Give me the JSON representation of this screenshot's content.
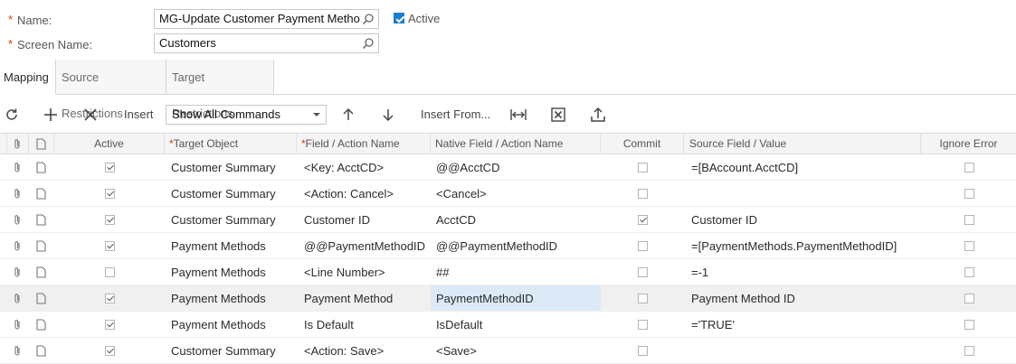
{
  "form": {
    "name_label": "Name:",
    "name_value": "MG-Update Customer Payment Metho",
    "screen_label": "Screen Name:",
    "screen_value": "Customers",
    "required_mark": "*",
    "active_label": "Active",
    "active_checked": true
  },
  "tabs": [
    {
      "label": "Mapping",
      "active": true
    },
    {
      "label": "Source Restrictions",
      "active": false
    },
    {
      "label": "Target Restrictions",
      "active": false
    }
  ],
  "toolbar": {
    "insert_label": "Insert",
    "command_filter": "Show All Commands",
    "insert_from_label": "Insert From..."
  },
  "grid": {
    "headers": {
      "active": "Active",
      "target_object": "Target Object",
      "field_action": "Field / Action Name",
      "native_field": "Native Field / Action Name",
      "commit": "Commit",
      "source_field": "Source Field / Value",
      "ignore_error": "Ignore Error"
    },
    "rows": [
      {
        "active": true,
        "target": "Customer Summary",
        "field": "<Key: AcctCD>",
        "native": "@@AcctCD",
        "commit": false,
        "source": "=[BAccount.AcctCD]",
        "ignore": false
      },
      {
        "active": true,
        "target": "Customer Summary",
        "field": "<Action: Cancel>",
        "native": "<Cancel>",
        "commit": false,
        "source": "",
        "ignore": false
      },
      {
        "active": true,
        "target": "Customer Summary",
        "field": "Customer ID",
        "native": "AcctCD",
        "commit": true,
        "source": "Customer ID",
        "ignore": false
      },
      {
        "active": true,
        "target": "Payment Methods",
        "field": "@@PaymentMethodID",
        "native": "@@PaymentMethodID",
        "commit": false,
        "source": "=[PaymentMethods.PaymentMethodID]",
        "ignore": false
      },
      {
        "active": false,
        "target": "Payment Methods",
        "field": "<Line Number>",
        "native": "##",
        "commit": false,
        "source": "=-1",
        "ignore": false
      },
      {
        "active": true,
        "target": "Payment Methods",
        "field": "Payment Method",
        "native": "PaymentMethodID",
        "commit": false,
        "source": "Payment Method ID",
        "ignore": false,
        "selected": true
      },
      {
        "active": true,
        "target": "Payment Methods",
        "field": "Is Default",
        "native": "IsDefault",
        "commit": false,
        "source": "='TRUE'",
        "ignore": false
      },
      {
        "active": true,
        "target": "Customer Summary",
        "field": "<Action: Save>",
        "native": "<Save>",
        "commit": false,
        "source": "",
        "ignore": false
      }
    ]
  },
  "colors": {
    "accent": "#1e7dcc",
    "required": "#d83b01",
    "selected_row": "#f0f0f0",
    "focused_cell": "#dce9f7"
  }
}
